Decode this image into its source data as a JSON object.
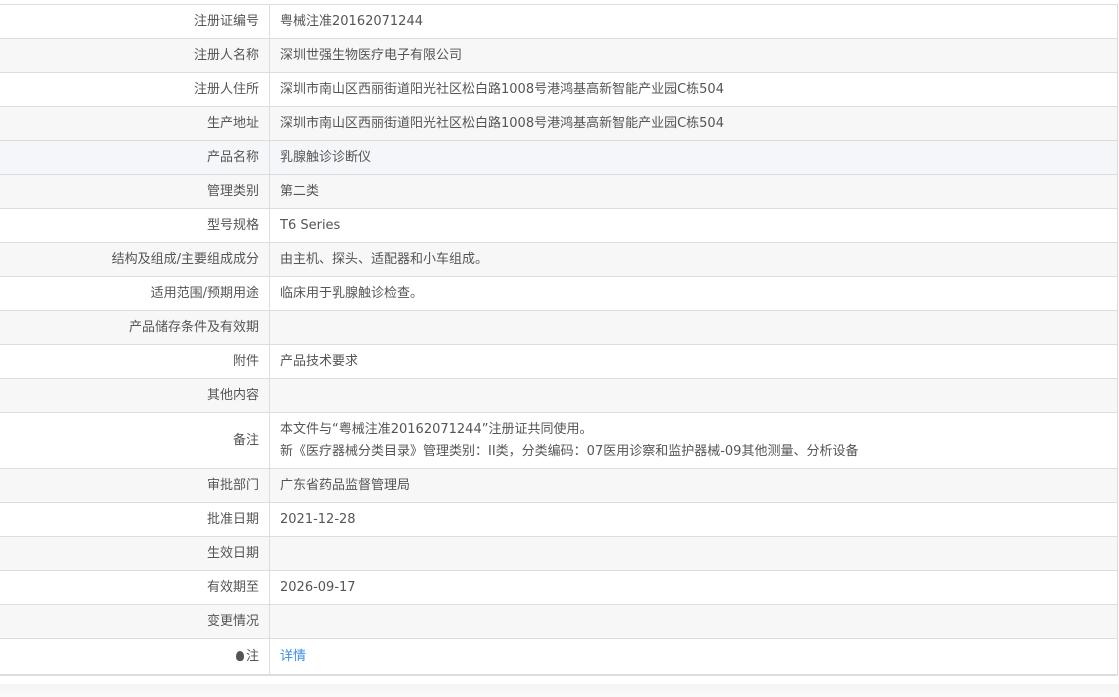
{
  "rows": [
    {
      "label": "注册证编号",
      "value": "粤械注准20162071244"
    },
    {
      "label": "注册人名称",
      "value": "深圳世强生物医疗电子有限公司"
    },
    {
      "label": "注册人住所",
      "value": "深圳市南山区西丽街道阳光社区松白路1008号港鸿基高新智能产业园C栋504"
    },
    {
      "label": "生产地址",
      "value": "深圳市南山区西丽街道阳光社区松白路1008号港鸿基高新智能产业园C栋504"
    },
    {
      "label": "产品名称",
      "value": "乳腺触诊诊断仪"
    },
    {
      "label": "管理类别",
      "value": "第二类"
    },
    {
      "label": "型号规格",
      "value": "T6 Series"
    },
    {
      "label": "结构及组成/主要组成成分",
      "value": "由主机、探头、适配器和小车组成。"
    },
    {
      "label": "适用范围/预期用途",
      "value": "临床用于乳腺触诊检查。"
    },
    {
      "label": "产品储存条件及有效期",
      "value": ""
    },
    {
      "label": "附件",
      "value": "产品技术要求"
    },
    {
      "label": "其他内容",
      "value": ""
    },
    {
      "label": "备注",
      "value": "本文件与“粤械注准20162071244”注册证共同使用。",
      "value2": "新《医疗器械分类目录》管理类别：II类，分类编码：07医用诊察和监护器械-09其他测量、分析设备"
    },
    {
      "label": "审批部门",
      "value": "广东省药品监督管理局"
    },
    {
      "label": "批准日期",
      "value": "2021-12-28"
    },
    {
      "label": "生效日期",
      "value": ""
    },
    {
      "label": "有效期至",
      "value": "2026-09-17"
    },
    {
      "label": "变更情况",
      "value": ""
    },
    {
      "label": "注",
      "value": "详情",
      "icon": "lightbulb-icon"
    }
  ]
}
